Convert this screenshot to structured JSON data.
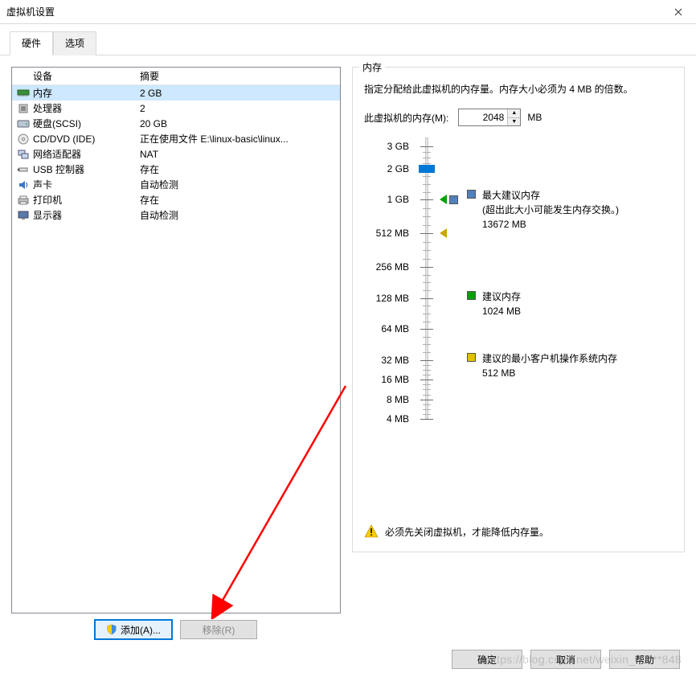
{
  "window": {
    "title": "虚拟机设置"
  },
  "tabs": [
    {
      "label": "硬件",
      "active": true
    },
    {
      "label": "选项",
      "active": false
    }
  ],
  "hardware": {
    "header": {
      "device": "设备",
      "summary": "摘要"
    },
    "rows": [
      {
        "icon": "memory-icon",
        "device": "内存",
        "summary": "2 GB",
        "selected": true
      },
      {
        "icon": "cpu-icon",
        "device": "处理器",
        "summary": "2"
      },
      {
        "icon": "hdd-icon",
        "device": "硬盘(SCSI)",
        "summary": "20 GB"
      },
      {
        "icon": "cddvd-icon",
        "device": "CD/DVD (IDE)",
        "summary": "正在使用文件 E:\\linux-basic\\linux..."
      },
      {
        "icon": "network-icon",
        "device": "网络适配器",
        "summary": "NAT"
      },
      {
        "icon": "usb-icon",
        "device": "USB 控制器",
        "summary": "存在"
      },
      {
        "icon": "sound-icon",
        "device": "声卡",
        "summary": "自动检测"
      },
      {
        "icon": "printer-icon",
        "device": "打印机",
        "summary": "存在"
      },
      {
        "icon": "display-icon",
        "device": "显示器",
        "summary": "自动检测"
      }
    ],
    "buttons": {
      "add": "添加(A)...",
      "remove": "移除(R)"
    }
  },
  "memory": {
    "group_title": "内存",
    "description": "指定分配给此虚拟机的内存量。内存大小必须为 4 MB 的倍数。",
    "field_label": "此虚拟机的内存(M):",
    "value": "2048",
    "unit": "MB",
    "ticks": [
      {
        "label": "3 GB",
        "pct": 3
      },
      {
        "label": "2 GB",
        "pct": 11
      },
      {
        "label": "1 GB",
        "pct": 22
      },
      {
        "label": "512 MB",
        "pct": 34
      },
      {
        "label": "256 MB",
        "pct": 46
      },
      {
        "label": "128 MB",
        "pct": 57
      },
      {
        "label": "64 MB",
        "pct": 68
      },
      {
        "label": "32 MB",
        "pct": 79
      },
      {
        "label": "16 MB",
        "pct": 86
      },
      {
        "label": "8 MB",
        "pct": 93
      },
      {
        "label": "4 MB",
        "pct": 100
      }
    ],
    "thumb_pct": 11,
    "markers": [
      {
        "name": "max-recommended",
        "pct": 22,
        "tri_color": "#00a000",
        "sq_color": "#4f81bd"
      },
      {
        "name": "basic-mark",
        "pct": 34,
        "tri_color": "#c7a700",
        "sq_color": null
      }
    ],
    "legend": [
      {
        "name": "max-recommended-legend",
        "top_pct": 18,
        "color": "#4f81bd",
        "title": "最大建议内存",
        "sub": "(超出此大小可能发生内存交换。)",
        "value": "13672 MB"
      },
      {
        "name": "recommended-legend",
        "top_pct": 54,
        "color": "#00a000",
        "title": "建议内存",
        "sub": "",
        "value": "1024 MB"
      },
      {
        "name": "min-guest-legend",
        "top_pct": 76,
        "color": "#e0c000",
        "title": "建议的最小客户机操作系统内存",
        "sub": "",
        "value": "512 MB"
      }
    ],
    "warning": "必须先关闭虚拟机，才能降低内存量。"
  },
  "footer": {
    "ok": "确定",
    "cancel": "取消",
    "help": "帮助"
  },
  "watermark": "https://blog.csdn.net/weixin_42***848"
}
